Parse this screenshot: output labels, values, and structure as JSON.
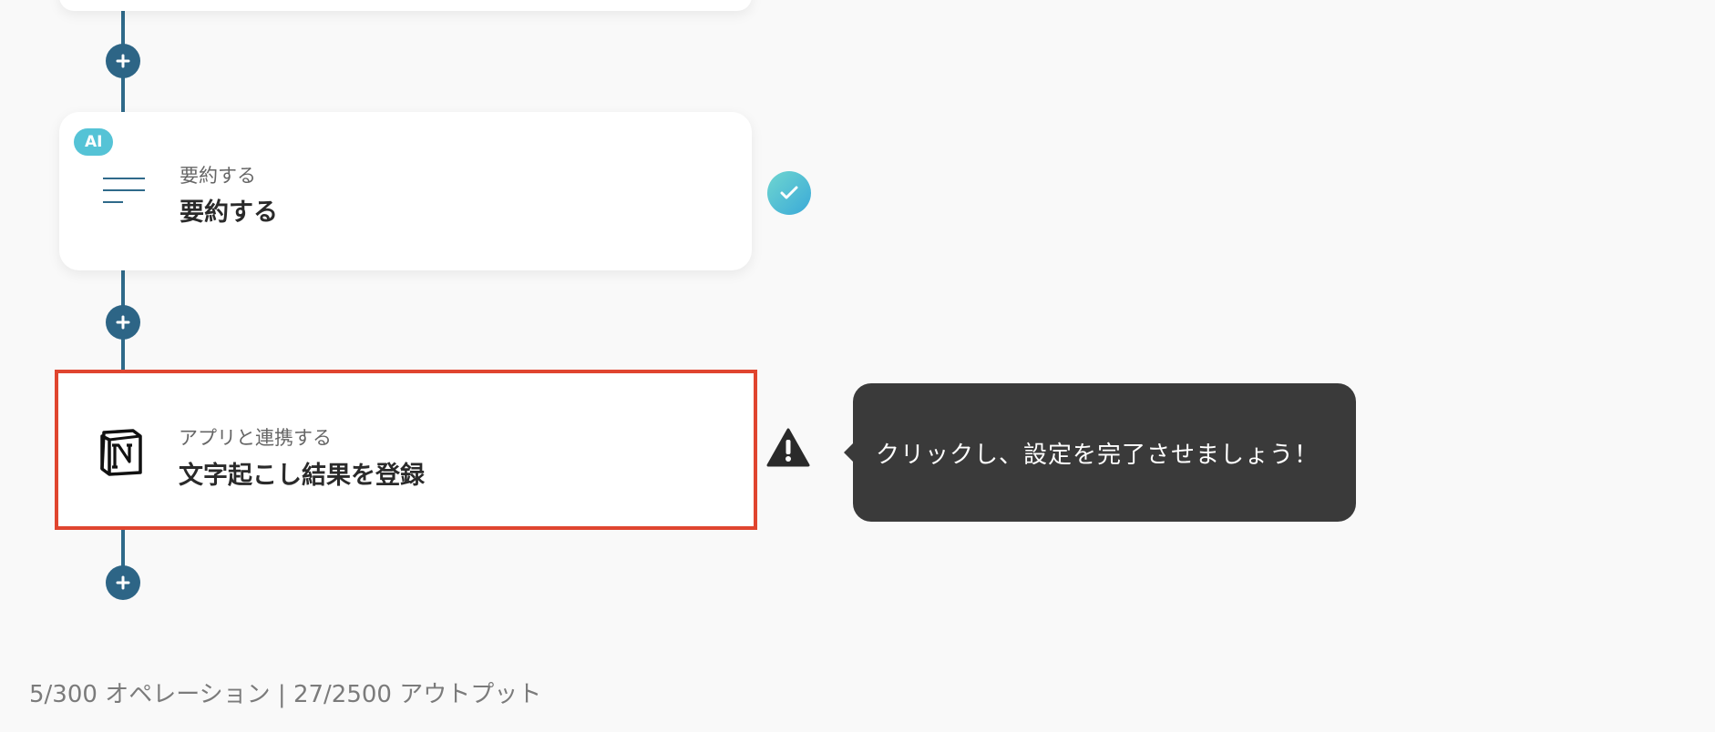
{
  "workflow": {
    "steps": [
      {
        "badge": "AI",
        "subtitle": "要約する",
        "title": "要約する",
        "icon": "summary-lines-icon",
        "status": "complete"
      },
      {
        "subtitle": "アプリと連携する",
        "title": "文字起こし結果を登録",
        "icon": "notion-icon",
        "status": "warning"
      }
    ],
    "tooltip": "クリックし、設定を完了させましょう！"
  },
  "usage": {
    "text": "5/300 オペレーション | 27/2500 アウトプット"
  },
  "colors": {
    "flow_line": "#2f6a8a",
    "add_button": "#2d6586",
    "ai_badge": "#55c3d6",
    "highlight_border": "#e0452f",
    "tooltip_bg": "#3a3a3a"
  }
}
